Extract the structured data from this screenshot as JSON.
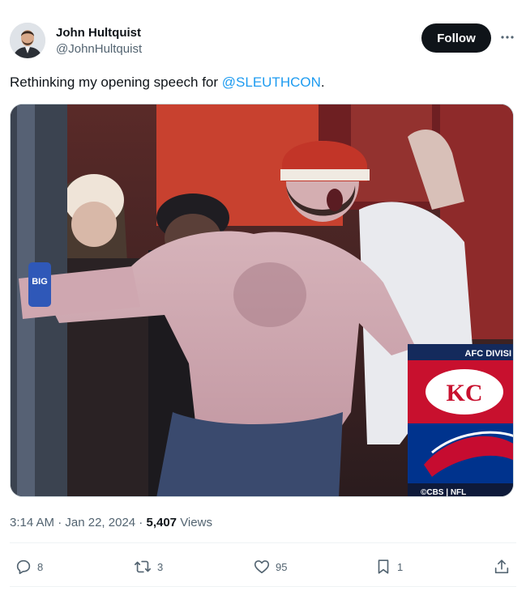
{
  "author": {
    "display_name": "John Hultquist",
    "handle": "@JohnHultquist"
  },
  "follow_label": "Follow",
  "tweet": {
    "text_before": "Rethinking my opening speech for ",
    "mention": "@SLEUTHCON",
    "text_after": "."
  },
  "media_overlay": {
    "scorebug_title": "AFC DIVISI",
    "scorebug_team": "KC",
    "network": "©CBS | NFL",
    "can_text": "BIG"
  },
  "meta": {
    "time": "3:14 AM",
    "separator": " · ",
    "date": "Jan 22, 2024",
    "views_count": "5,407",
    "views_label": " Views"
  },
  "actions": {
    "replies": "8",
    "reposts": "3",
    "likes": "95",
    "bookmarks": "1"
  },
  "colors": {
    "accent": "#1d9bf0",
    "text": "#0f1419",
    "muted": "#536471",
    "follow_bg": "#0f1419"
  },
  "icons": [
    "more-icon",
    "reply-icon",
    "repost-icon",
    "like-icon",
    "bookmark-icon",
    "share-icon"
  ]
}
